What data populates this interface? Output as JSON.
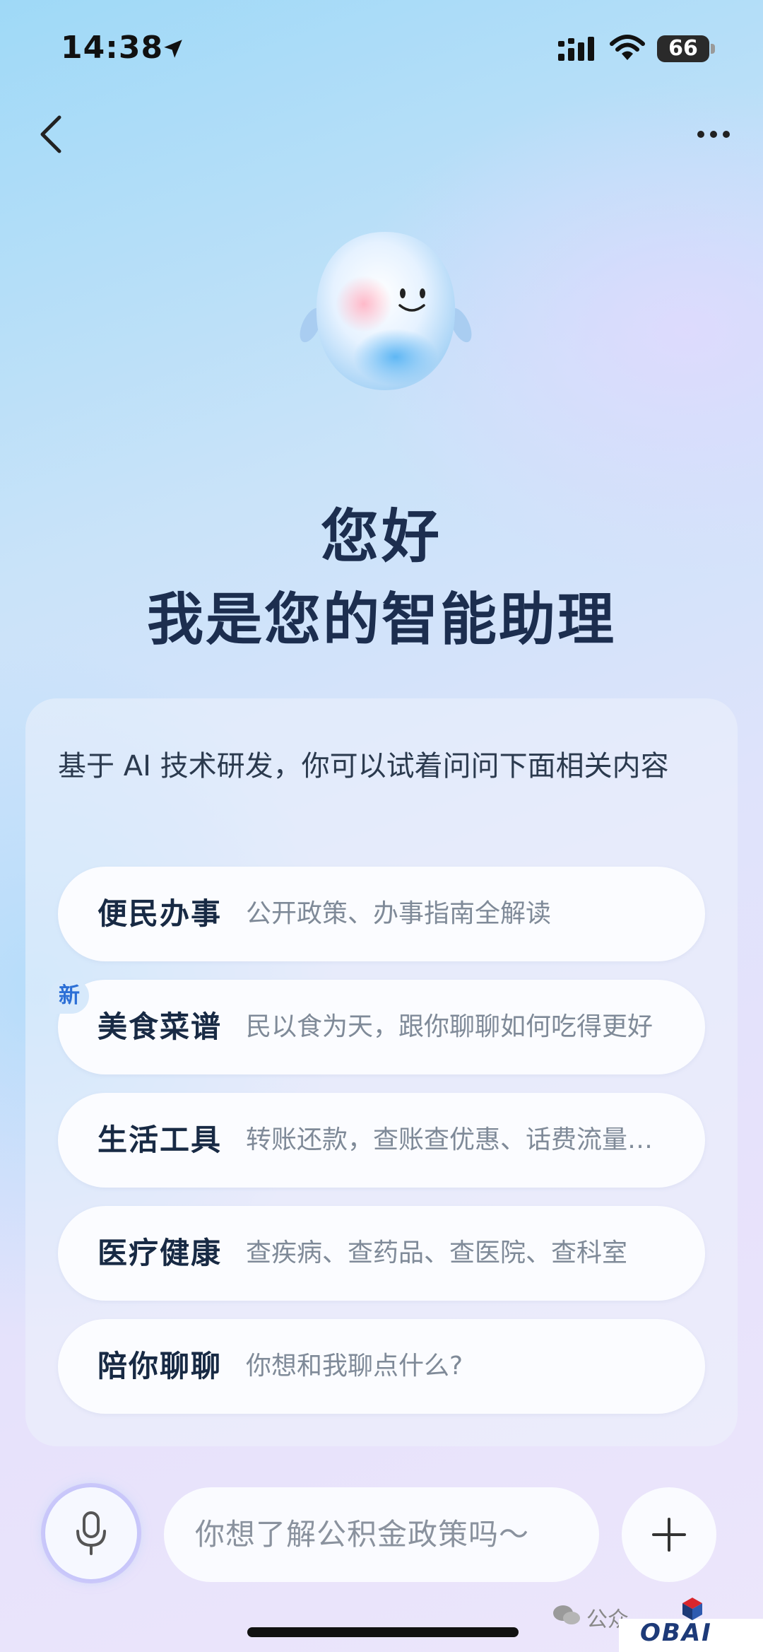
{
  "status_bar": {
    "time": "14:38",
    "battery": "66"
  },
  "greeting": {
    "line1": "您好",
    "line2": "我是您的智能助理"
  },
  "intro": "基于 AI 技术研发，你可以试着问问下面相关内容",
  "topics": [
    {
      "title": "便民办事",
      "desc": "公开政策、办事指南全解读"
    },
    {
      "title": "美食菜谱",
      "desc": "民以食为天，跟你聊聊如何吃得更好",
      "badge": "新"
    },
    {
      "title": "生活工具",
      "desc": "转账还款，查账查优惠、话费流量…"
    },
    {
      "title": "医疗健康",
      "desc": "查疾病、查药品、查医院、查科室"
    },
    {
      "title": "陪你聊聊",
      "desc": "你想和我聊点什么?"
    }
  ],
  "input": {
    "placeholder": "你想了解公积金政策吗～"
  },
  "footer": {
    "watermark": "公众",
    "logo": "OBAI"
  },
  "colors": {
    "accent": "#2c6fd6",
    "title": "#1c2e4f"
  }
}
